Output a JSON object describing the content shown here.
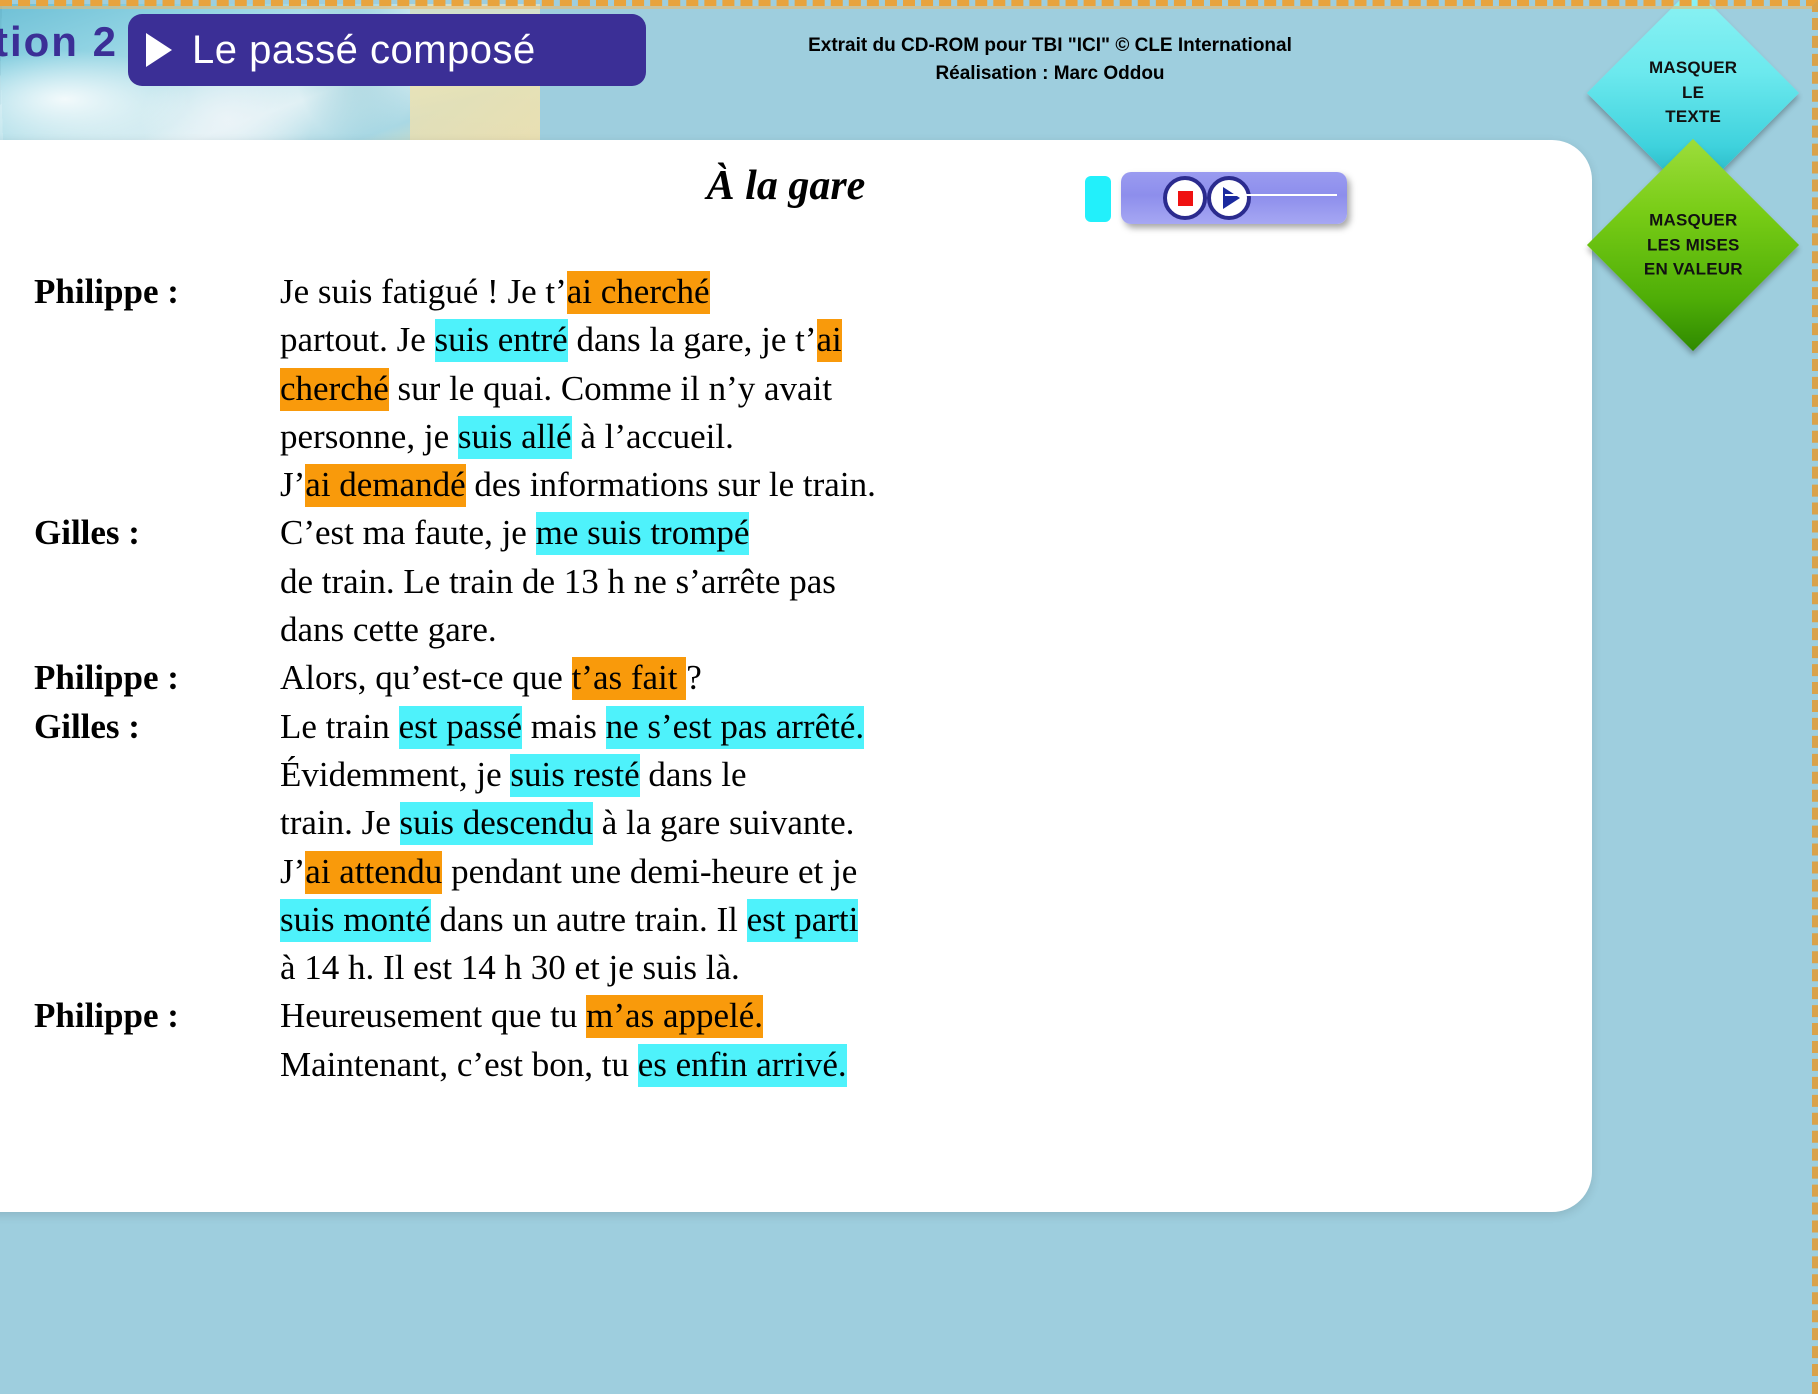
{
  "header": {
    "lesson_number": "tion  2",
    "title": "Le passé composé",
    "credit_line_1": "Extrait du CD-ROM pour TBI \"ICI\" © CLE International",
    "credit_line_2": "Réalisation : Marc Oddou"
  },
  "buttons": {
    "hide_text": {
      "line1": "MASQUER",
      "line2": "LE",
      "line3": "TEXTE"
    },
    "hide_highlights": {
      "line1": "MASQUER",
      "line2": "LES MISES",
      "line3": "EN VALEUR"
    }
  },
  "player": {
    "stop_label": "stop",
    "play_label": "play"
  },
  "document": {
    "title": "À la gare",
    "turns": [
      {
        "speaker": "Philippe :",
        "lines": [
          [
            {
              "t": "Je suis fatigué ! Je t’",
              "h": "none"
            },
            {
              "t": "ai cherché",
              "h": "orange"
            }
          ],
          [
            {
              "t": "partout. Je ",
              "h": "none"
            },
            {
              "t": "suis entré",
              "h": "cyan"
            },
            {
              "t": " dans la gare, je t’",
              "h": "none"
            },
            {
              "t": "ai",
              "h": "orange"
            }
          ],
          [
            {
              "t": "cherché",
              "h": "orange"
            },
            {
              "t": " sur le quai. Comme il n’y avait",
              "h": "none"
            }
          ],
          [
            {
              "t": "personne, je ",
              "h": "none"
            },
            {
              "t": "suis allé",
              "h": "cyan"
            },
            {
              "t": " à l’accueil.",
              "h": "none"
            }
          ],
          [
            {
              "t": "J’",
              "h": "none"
            },
            {
              "t": "ai demandé",
              "h": "orange"
            },
            {
              "t": " des informations sur le train.",
              "h": "none"
            }
          ]
        ]
      },
      {
        "speaker": "Gilles :",
        "lines": [
          [
            {
              "t": "C’est ma faute, je ",
              "h": "none"
            },
            {
              "t": "me suis trompé",
              "h": "cyan"
            }
          ],
          [
            {
              "t": "de train. Le train de 13 h ne s’arrête pas",
              "h": "none"
            }
          ],
          [
            {
              "t": "dans cette gare.",
              "h": "none"
            }
          ]
        ]
      },
      {
        "speaker": "Philippe :",
        "lines": [
          [
            {
              "t": "Alors, qu’est-ce que ",
              "h": "none"
            },
            {
              "t": "t’as fait ",
              "h": "orange"
            },
            {
              "t": "?",
              "h": "none"
            }
          ]
        ]
      },
      {
        "speaker": "Gilles :",
        "lines": [
          [
            {
              "t": "Le train ",
              "h": "none"
            },
            {
              "t": "est passé",
              "h": "cyan"
            },
            {
              "t": " mais ",
              "h": "none"
            },
            {
              "t": "ne s’est pas arrêté.",
              "h": "cyan"
            }
          ],
          [
            {
              "t": "Évidemment, je ",
              "h": "none"
            },
            {
              "t": "suis resté",
              "h": "cyan"
            },
            {
              "t": " dans le",
              "h": "none"
            }
          ],
          [
            {
              "t": "train. Je ",
              "h": "none"
            },
            {
              "t": "suis descendu",
              "h": "cyan"
            },
            {
              "t": " à la gare suivante.",
              "h": "none"
            }
          ],
          [
            {
              "t": "J’",
              "h": "none"
            },
            {
              "t": "ai attendu",
              "h": "orange"
            },
            {
              "t": " pendant une demi-heure et je",
              "h": "none"
            }
          ],
          [
            {
              "t": "suis monté",
              "h": "cyan"
            },
            {
              "t": " dans un autre train. Il ",
              "h": "none"
            },
            {
              "t": "est parti",
              "h": "cyan"
            }
          ],
          [
            {
              "t": "à 14 h. Il est 14 h 30 et je suis là.",
              "h": "none"
            }
          ]
        ]
      },
      {
        "speaker": "Philippe :",
        "lines": [
          [
            {
              "t": "Heureusement que tu ",
              "h": "none"
            },
            {
              "t": "m’as appelé.",
              "h": "orange"
            }
          ],
          [
            {
              "t": "Maintenant, c’est bon, tu ",
              "h": "none"
            },
            {
              "t": "es enfin arrivé.",
              "h": "cyan"
            }
          ]
        ]
      }
    ]
  },
  "colors": {
    "background": "#9ecede",
    "title_pill": "#3b2f96",
    "highlight_orange": "#f99a0b",
    "highlight_cyan": "#4ef2fb",
    "diamond_cyan": "#6ce9ee",
    "diamond_green": "#78cc16"
  }
}
